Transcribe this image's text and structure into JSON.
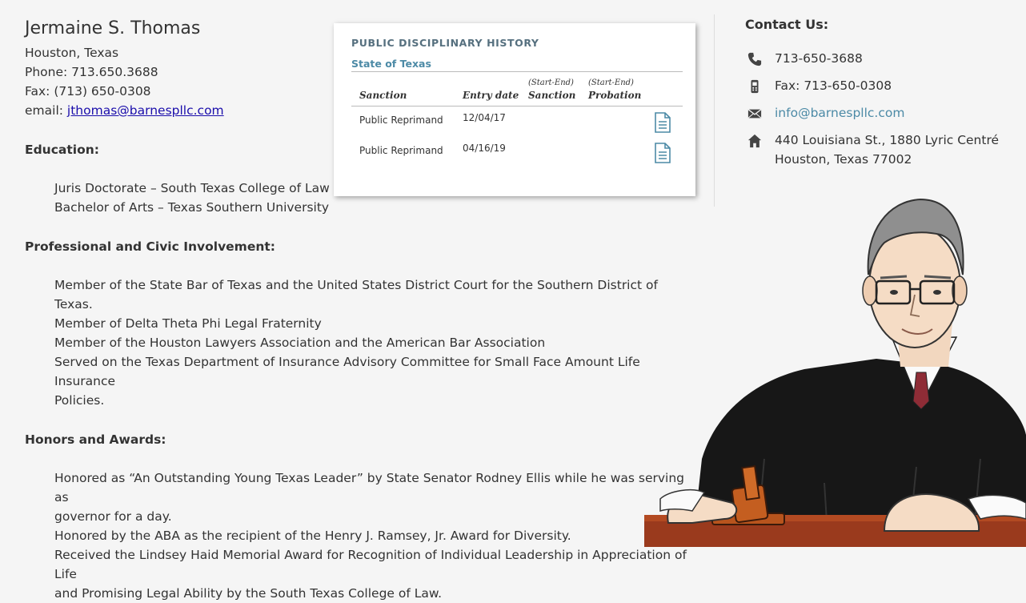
{
  "profile": {
    "name": "Jermaine S. Thomas",
    "location": "Houston, Texas",
    "phone": "Phone: 713.650.3688",
    "fax": "Fax: (713) 650-0308",
    "email_label": "email: ",
    "email": "jthomas@barnespllc.com"
  },
  "education": {
    "heading": "Education:",
    "items": [
      "Juris Doctorate – South Texas College of Law",
      "Bachelor of Arts – Texas Southern University"
    ]
  },
  "involvement": {
    "heading": "Professional and Civic Involvement:",
    "items": [
      "Member of the State Bar of Texas and the United States District Court for the Southern District of Texas.",
      "Member of Delta Theta Phi Legal Fraternity",
      "Member of the Houston Lawyers Association and the American Bar Association",
      "Served on the Texas Department of Insurance Advisory Committee for Small Face Amount Life Insurance",
      "Policies."
    ]
  },
  "honors": {
    "heading": "Honors and Awards:",
    "items": [
      "Honored as “An Outstanding Young Texas Leader” by State Senator Rodney Ellis while he was serving as",
      "governor for a day.",
      "Honored by the ABA as the recipient of the Henry J. Ramsey, Jr. Award for Diversity.",
      "Received the Lindsey Haid Memorial Award for Recognition of Individual Leadership in Appreciation of Life",
      "and Promising Legal Ability by the South Texas College of Law."
    ]
  },
  "disciplinary": {
    "title": "PUBLIC DISCIPLINARY HISTORY",
    "state": "State of Texas",
    "columns": {
      "sanction": "Sanction",
      "entry_date": "Entry date",
      "start_end_1": "(Start-End)",
      "sanction2": "Sanction",
      "start_end_2": "(Start-End)",
      "probation": "Probation"
    },
    "rows": [
      {
        "sanction": "Public Reprimand",
        "date": "12/04/17"
      },
      {
        "sanction": "Public Reprimand",
        "date": "04/16/19"
      }
    ],
    "icon": "document-icon"
  },
  "contact": {
    "title": "Contact Us:",
    "phone": "713-650-3688",
    "fax": "Fax: 713-650-0308",
    "email": "info@barnespllc.com",
    "address1": "440 Louisiana St., 1880 Lyric Centré",
    "address2": "Houston, Texas 77002",
    "icons": [
      "phone-icon",
      "fax-icon",
      "mail-icon",
      "home-icon"
    ]
  },
  "colors": {
    "background": "#f5f5f5",
    "accent": "#4c8aa6",
    "heading_blue": "#56707f",
    "link": "#1a0dab"
  }
}
